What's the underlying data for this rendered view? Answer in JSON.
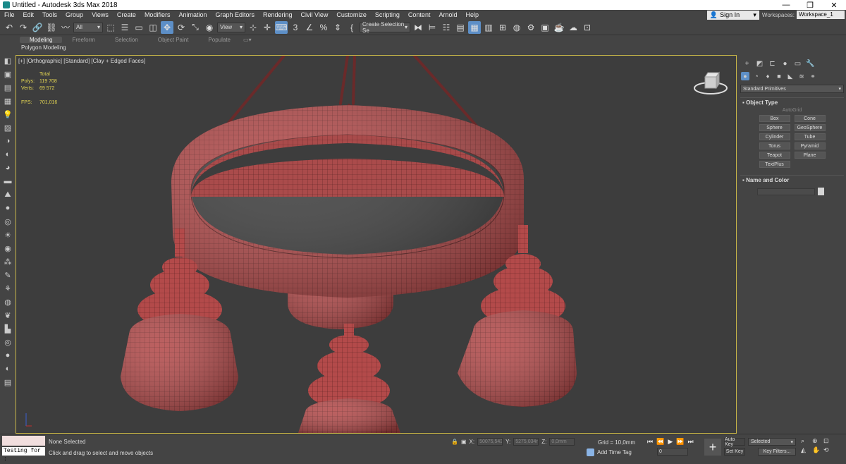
{
  "window": {
    "title": "Untitled - Autodesk 3ds Max 2018",
    "minimize": "—",
    "restore": "❐",
    "close": "✕"
  },
  "menu": [
    "File",
    "Edit",
    "Tools",
    "Group",
    "Views",
    "Create",
    "Modifiers",
    "Animation",
    "Graph Editors",
    "Rendering",
    "Civil View",
    "Customize",
    "Scripting",
    "Content",
    "Arnold",
    "Help"
  ],
  "account": {
    "signin": "Sign In",
    "workspaces_label": "Workspaces:",
    "workspace": "Workspace_1"
  },
  "toolbar": {
    "filter": "All",
    "ref_coord": "View",
    "angle_snap": "3",
    "named_selection": "Create Selection Se"
  },
  "ribbon": {
    "tabs": [
      "Modeling",
      "Freeform",
      "Selection",
      "Object Paint",
      "Populate"
    ],
    "active_tab": "Modeling",
    "sub_label": "Polygon Modeling"
  },
  "viewport": {
    "label": "[+] [Orthographic] [Standard] [Clay + Edged Faces]",
    "stats": {
      "header": "Total",
      "polys_label": "Polys:",
      "polys": "119 708",
      "verts_label": "Verts:",
      "verts": "69 572",
      "fps_label": "FPS:",
      "fps": "701,016"
    },
    "mesh_color": "#b34a4a",
    "background": "#3d3d3d"
  },
  "command_panel": {
    "category": "Standard Primitives",
    "object_type_title": "Object Type",
    "autogrid": "AutoGrid",
    "buttons": [
      "Box",
      "Cone",
      "Sphere",
      "GeoSphere",
      "Cylinder",
      "Tube",
      "Torus",
      "Pyramid",
      "Teapot",
      "Plane",
      "TextPlus"
    ],
    "name_color_title": "Name and Color"
  },
  "status": {
    "maxscript_text": "Testing for :",
    "selection": "None Selected",
    "prompt": "Click and drag to select and move objects",
    "x_label": "X:",
    "x": "50075,543",
    "y_label": "Y:",
    "y": "5275,034n",
    "z_label": "Z:",
    "z": "0,0mm",
    "grid": "Grid = 10,0mm",
    "add_time_tag": "Add Time Tag",
    "frame": "0",
    "auto_key": "Auto Key",
    "set_key": "Set Key",
    "selected": "Selected",
    "key_filters": "Key Filters..."
  }
}
